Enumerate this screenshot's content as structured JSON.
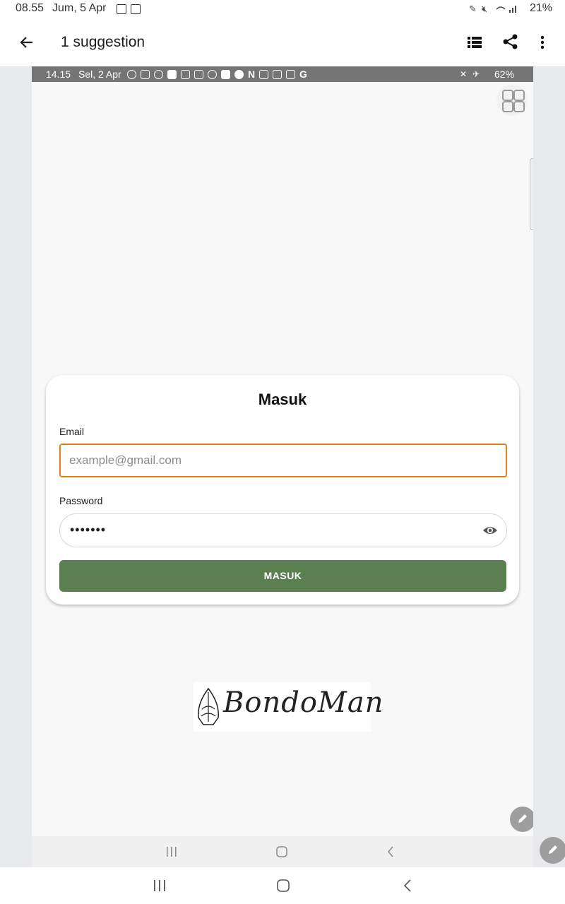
{
  "device_status": {
    "time": "08.55",
    "date": "Jum, 5 Apr",
    "battery": "21%"
  },
  "app_bar": {
    "title": "1 suggestion"
  },
  "screenshot": {
    "status": {
      "time": "14.15",
      "date": "Sel, 2 Apr",
      "battery": "62%"
    },
    "login": {
      "title": "Masuk",
      "email_label": "Email",
      "email_placeholder": "example@gmail.com",
      "password_label": "Password",
      "password_value": "•••••••",
      "submit_label": "MASUK"
    },
    "logo_text": "BondoMan"
  },
  "colors": {
    "accent_focus": "#e0821c",
    "primary_button": "#5c7f51",
    "status_bar_inner": "#757575"
  },
  "icons": [
    "back-arrow-icon",
    "list-icon",
    "share-icon",
    "more-vert-icon",
    "grid-icon",
    "eye-icon",
    "edit-icon",
    "recents-icon",
    "home-icon",
    "back-icon"
  ]
}
